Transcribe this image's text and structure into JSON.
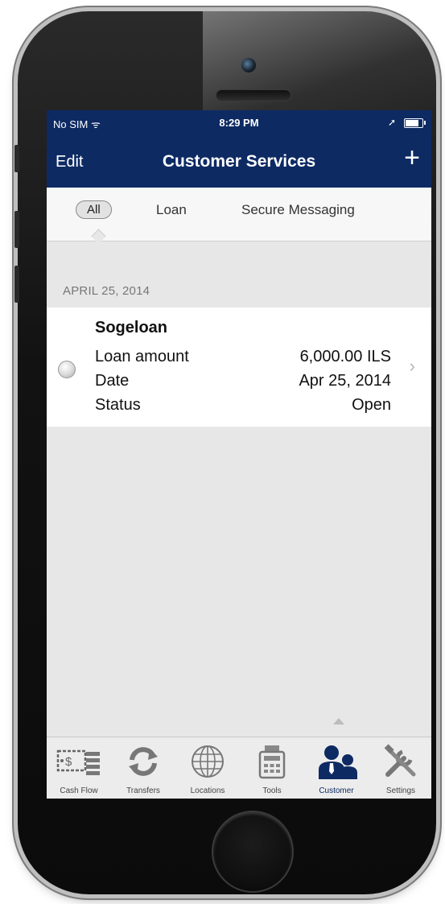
{
  "status_bar": {
    "carrier": "No SIM ᯤ",
    "time": "8:29 PM",
    "location_glyph": "➚"
  },
  "nav": {
    "edit_label": "Edit",
    "title": "Customer Services",
    "add_symbol": "+"
  },
  "filter": {
    "tabs": [
      {
        "label": "All",
        "selected": true
      },
      {
        "label": "Loan",
        "selected": false
      },
      {
        "label": "Secure Messaging",
        "selected": false
      }
    ]
  },
  "list": {
    "section_date": "APRIL 25, 2014",
    "item": {
      "title": "Sogeloan",
      "rows": [
        {
          "label": "Loan amount",
          "value": "6,000.00 ILS"
        },
        {
          "label": "Date",
          "value": "Apr 25, 2014"
        },
        {
          "label": "Status",
          "value": "Open"
        }
      ]
    }
  },
  "tab_bar": {
    "items": [
      {
        "label": "Cash Flow",
        "icon": "cash-flow-icon"
      },
      {
        "label": "Transfers",
        "icon": "transfers-icon"
      },
      {
        "label": "Locations",
        "icon": "globe-icon"
      },
      {
        "label": "Tools",
        "icon": "calculator-icon"
      },
      {
        "label": "Customer",
        "icon": "customer-icon",
        "active": true
      },
      {
        "label": "Settings",
        "icon": "tools-icon"
      }
    ]
  },
  "colors": {
    "brand_navy": "#0d2a63",
    "background": "#e7e7e7"
  }
}
